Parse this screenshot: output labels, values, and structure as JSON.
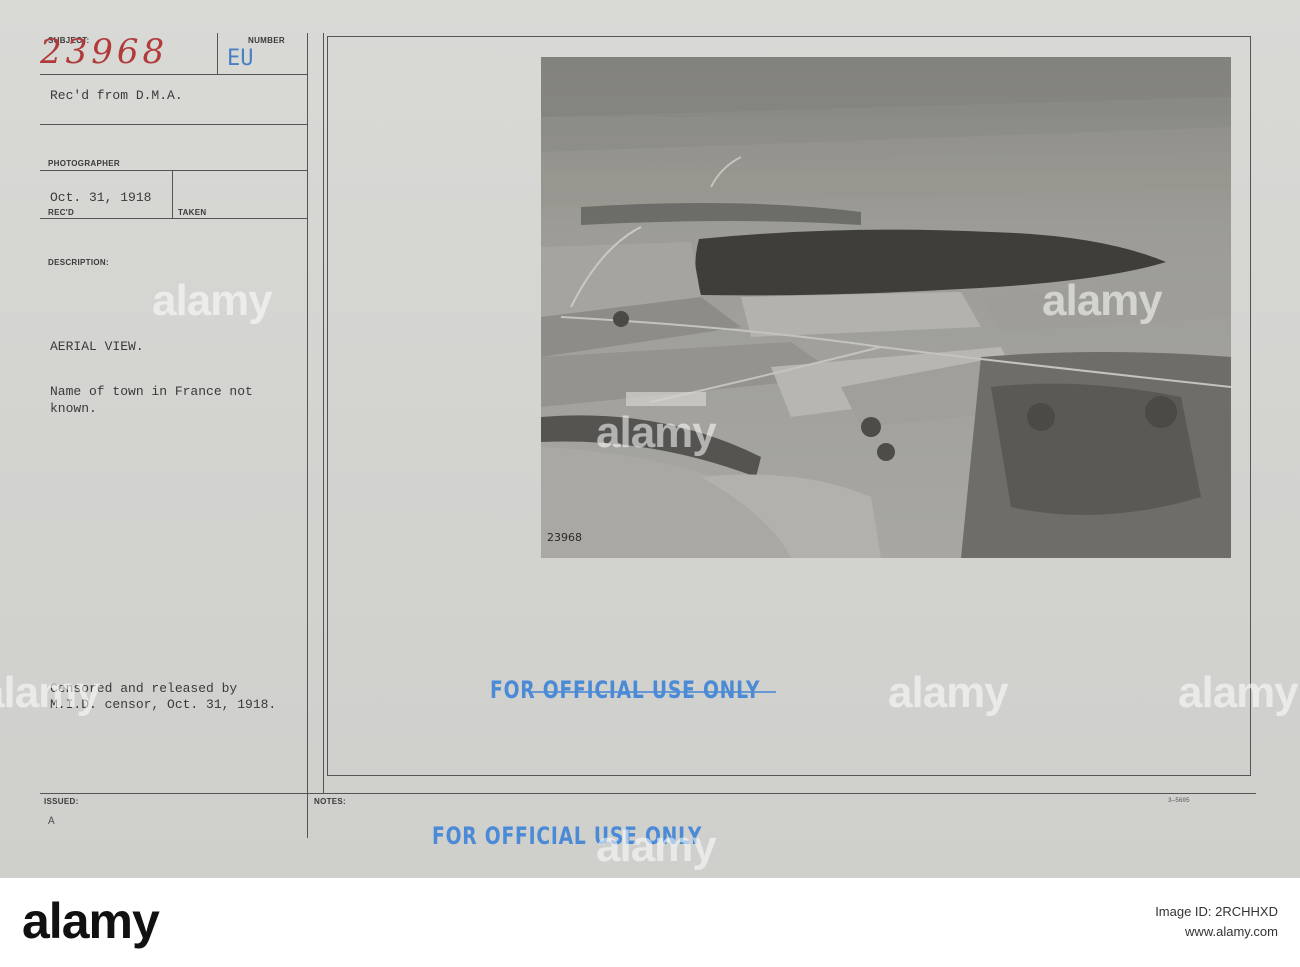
{
  "card": {
    "subject_label": "SUBJECT:",
    "number_label": "NUMBER",
    "subject_number": "23968",
    "number_code": "EU",
    "received_from": "Rec'd from D.M.A.",
    "photographer_label": "PHOTOGRAPHER",
    "date_received": "Oct. 31, 1918",
    "recd_label": "REC'D",
    "taken_label": "TAKEN",
    "description_label": "DESCRIPTION:",
    "description_title": "AERIAL VIEW.",
    "description_line1": "Name of town in France not",
    "description_line2": "known.",
    "censor_line1": "Censored and released by",
    "censor_line2": "M.I.D. censor, Oct. 31, 1918.",
    "issued_label": "ISSUED:",
    "notes_label": "NOTES:",
    "issued_mark": "A",
    "form_code": "3—5605",
    "photo_caption": "23968",
    "stamp_inner": "FOR OFFICIAL USE ONLY",
    "stamp_outer": "FOR OFFICIAL USE ONLY"
  },
  "watermarks": [
    "alamy",
    "alamy",
    "alamy",
    "alamy",
    "alamy",
    "alamy",
    "alamy"
  ],
  "footer": {
    "brand": "alamy",
    "image_id": "Image ID: 2RCHHXD",
    "site": "www.alamy.com"
  }
}
